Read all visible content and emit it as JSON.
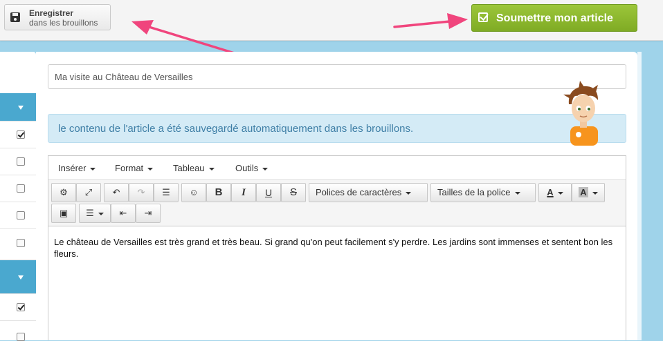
{
  "header": {
    "save_button": {
      "line1": "Enregistrer",
      "line2": "dans les brouillons",
      "icon": "floppy-disk-icon"
    },
    "submit_button": {
      "label": "Soumettre mon article",
      "icon": "check-square-icon",
      "color": "#8bb82d"
    }
  },
  "article": {
    "title_value": "Ma visite au Château de Versailles",
    "autosave_notice": "le contenu de l'article a été sauvegardé automatiquement dans les brouillons."
  },
  "sidebar": {
    "accent": "#4aa8cf",
    "checkboxes": [
      true,
      false,
      false,
      false,
      false,
      true,
      false
    ]
  },
  "editor": {
    "menus": [
      "Insérer",
      "Format",
      "Tableau",
      "Outils"
    ],
    "font_family_label": "Polices de caractères",
    "font_size_label": "Tailles de la police",
    "text_color_label": "A",
    "bg_color_label": "A",
    "bold": "B",
    "italic": "I",
    "underline": "U",
    "strike": "S",
    "content": "Le château de Versailles est très grand et très beau. Si grand qu'on peut facilement s'y perdre. Les jardins sont immenses et sentent bon les fleurs."
  }
}
